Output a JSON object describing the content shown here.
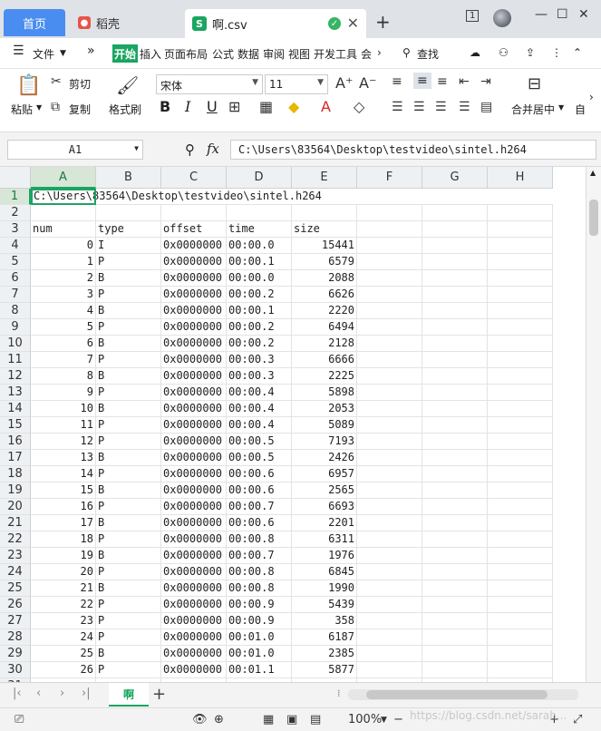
{
  "tabs": {
    "home": "首页",
    "daoke": "稻壳",
    "file": "啊.csv"
  },
  "menu": {
    "file": "文件",
    "more": "»",
    "items": [
      "开始",
      "插入",
      "页面布局",
      "公式",
      "数据",
      "审阅",
      "视图",
      "开发工具",
      "会"
    ],
    "search": "查找"
  },
  "ribbon": {
    "paste": "粘贴",
    "cut": "剪切",
    "copy": "复制",
    "format_painter": "格式刷",
    "font_name": "宋体",
    "font_size": "11",
    "bold": "B",
    "italic": "I",
    "underline": "U",
    "merge_center": "合并居中",
    "auto": "自"
  },
  "formula_bar": {
    "name_box": "A1",
    "fx": "fx",
    "value": "C:\\Users\\83564\\Desktop\\testvideo\\sintel.h264"
  },
  "grid": {
    "columns": [
      "A",
      "B",
      "C",
      "D",
      "E",
      "F",
      "G",
      "H"
    ],
    "row_numbers": [
      "1",
      "2",
      "3",
      "4",
      "5",
      "6",
      "7",
      "8",
      "9",
      "10",
      "11",
      "12",
      "13",
      "14",
      "15",
      "16",
      "17",
      "18",
      "19",
      "20",
      "21",
      "22",
      "23",
      "24",
      "25",
      "26",
      "27",
      "28",
      "29",
      "30",
      "31"
    ],
    "a1_text": "C:\\Users\\83564\\Desktop\\testvideo\\sintel.h264",
    "headers": [
      "num",
      "type",
      "offset",
      "time",
      "size"
    ],
    "rows": [
      [
        "0",
        "I",
        "0x0000000",
        "00:00.0",
        "15441"
      ],
      [
        "1",
        "P",
        "0x0000000",
        "00:00.1",
        "6579"
      ],
      [
        "2",
        "B",
        "0x0000000",
        "00:00.0",
        "2088"
      ],
      [
        "3",
        "P",
        "0x0000000",
        "00:00.2",
        "6626"
      ],
      [
        "4",
        "B",
        "0x0000000",
        "00:00.1",
        "2220"
      ],
      [
        "5",
        "P",
        "0x0000000",
        "00:00.2",
        "6494"
      ],
      [
        "6",
        "B",
        "0x0000000",
        "00:00.2",
        "2128"
      ],
      [
        "7",
        "P",
        "0x0000000",
        "00:00.3",
        "6666"
      ],
      [
        "8",
        "B",
        "0x0000000",
        "00:00.3",
        "2225"
      ],
      [
        "9",
        "P",
        "0x0000000",
        "00:00.4",
        "5898"
      ],
      [
        "10",
        "B",
        "0x0000000",
        "00:00.4",
        "2053"
      ],
      [
        "11",
        "P",
        "0x0000000",
        "00:00.4",
        "5089"
      ],
      [
        "12",
        "P",
        "0x0000000",
        "00:00.5",
        "7193"
      ],
      [
        "13",
        "B",
        "0x0000000",
        "00:00.5",
        "2426"
      ],
      [
        "14",
        "P",
        "0x0000000",
        "00:00.6",
        "6957"
      ],
      [
        "15",
        "B",
        "0x0000000",
        "00:00.6",
        "2565"
      ],
      [
        "16",
        "P",
        "0x0000000",
        "00:00.7",
        "6693"
      ],
      [
        "17",
        "B",
        "0x0000000",
        "00:00.6",
        "2201"
      ],
      [
        "18",
        "P",
        "0x0000000",
        "00:00.8",
        "6311"
      ],
      [
        "19",
        "B",
        "0x0000000",
        "00:00.7",
        "1976"
      ],
      [
        "20",
        "P",
        "0x0000000",
        "00:00.8",
        "6845"
      ],
      [
        "21",
        "B",
        "0x0000000",
        "00:00.8",
        "1990"
      ],
      [
        "22",
        "P",
        "0x0000000",
        "00:00.9",
        "5439"
      ],
      [
        "23",
        "P",
        "0x0000000",
        "00:00.9",
        "358"
      ],
      [
        "24",
        "P",
        "0x0000000",
        "00:01.0",
        "6187"
      ],
      [
        "25",
        "B",
        "0x0000000",
        "00:01.0",
        "2385"
      ],
      [
        "26",
        "P",
        "0x0000000",
        "00:01.1",
        "5877"
      ]
    ]
  },
  "sheets": [
    "啊"
  ],
  "status": {
    "zoom": "100%",
    "watermark": "https://blog.csdn.net/sarah..."
  },
  "colors": {
    "accent": "#1aa560",
    "home_tab": "#4a8df0"
  }
}
